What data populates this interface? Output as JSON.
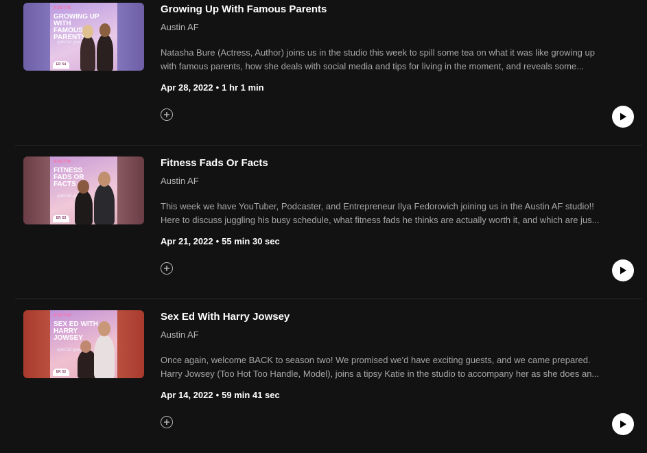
{
  "episodes": [
    {
      "title": "Growing Up With Famous Parents",
      "show": "Austin AF",
      "description_line1": "Natasha Bure (Actress, Author) joins us in the studio this week to spill some tea on what it was like growing up",
      "description_line2": "with famous parents, how she deals with social media and tips for living in the moment, and reveals some...",
      "date": "Apr 28, 2022",
      "separator": "•",
      "duration": "1 hr 1 min",
      "cover_brand": "AUSTIN",
      "cover_title": "Growing Up With Famous Parents",
      "cover_script": "special guest",
      "cover_episode": "EP. 54",
      "bg_color": "#7a6bb5"
    },
    {
      "title": "Fitness Fads Or Facts",
      "show": "Austin AF",
      "description_line1": "This week we have YouTuber, Podcaster, and Entrepreneur Ilya Fedorovich joining us in the Austin AF studio!!",
      "description_line2": "Here to discuss juggling his busy schedule, what fitness fads he thinks are actually worth it, and which are jus...",
      "date": "Apr 21, 2022",
      "separator": "•",
      "duration": "55 min 30 sec",
      "cover_brand": "AUSTIN",
      "cover_title": "Fitness Fads Or Facts",
      "cover_script": "special guest",
      "cover_episode": "EP. 53",
      "bg_color": "#8a5a62"
    },
    {
      "title": "Sex Ed With Harry Jowsey",
      "show": "Austin AF",
      "description_line1": "Once again, welcome BACK to season two! We promised we'd have exciting guests, and we came prepared.",
      "description_line2": "Harry Jowsey (Too Hot Too Handle, Model), joins a tipsy Katie in the studio to accompany her as she does an...",
      "date": "Apr 14, 2022",
      "separator": "•",
      "duration": "59 min 41 sec",
      "cover_brand": "AUSTIN",
      "cover_title": "Sex Ed With Harry Jowsey",
      "cover_script": "special guest",
      "cover_episode": "EP. 52",
      "bg_color": "#b84a3c"
    }
  ],
  "icons": {
    "add": "plus-circle-icon",
    "play": "play-icon"
  }
}
